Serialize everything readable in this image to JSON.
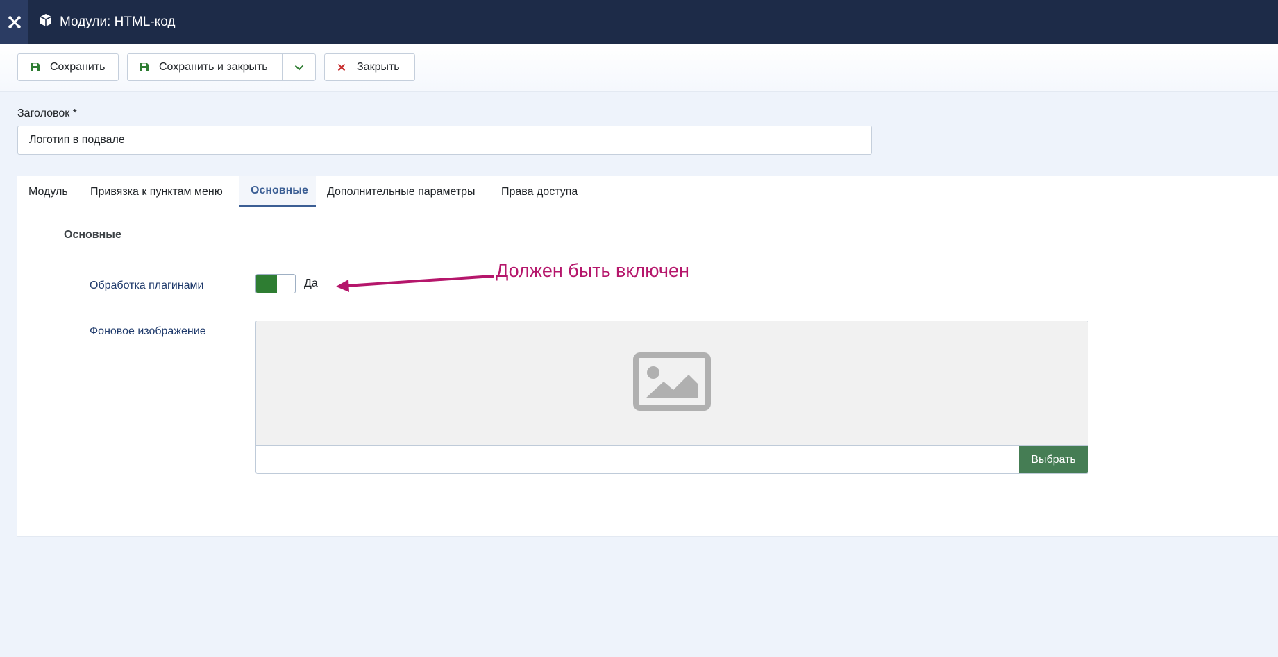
{
  "header": {
    "title": "Модули: HTML-код"
  },
  "toolbar": {
    "save_label": "Сохранить",
    "save_close_label": "Сохранить и закрыть",
    "close_label": "Закрыть"
  },
  "form": {
    "title_label": "Заголовок *",
    "title_value": "Логотип в подвале"
  },
  "tabs": [
    {
      "label": "Модуль"
    },
    {
      "label": "Привязка к пунктам меню"
    },
    {
      "label": "Основные",
      "active": true
    },
    {
      "label": "Дополнительные параметры"
    },
    {
      "label": "Права доступа"
    }
  ],
  "options": {
    "legend": "Основные",
    "plugins_label": "Обработка плагинами",
    "plugins_value": "Да",
    "plugins_enabled": true,
    "bg_image_label": "Фоновое изображение",
    "select_label": "Выбрать",
    "image_value": ""
  },
  "annotation": {
    "text": "Должен быть включен",
    "color": "#b5166b"
  },
  "colors": {
    "header_bg": "#1d2b48",
    "accent": "#3b5e94",
    "switch_on": "#2e7d32",
    "select_button": "#457d54"
  },
  "icons": [
    "joomla-logo-icon",
    "cube-icon",
    "save-icon",
    "chevron-down-icon",
    "close-icon",
    "image-placeholder-icon",
    "arrow-icon"
  ]
}
